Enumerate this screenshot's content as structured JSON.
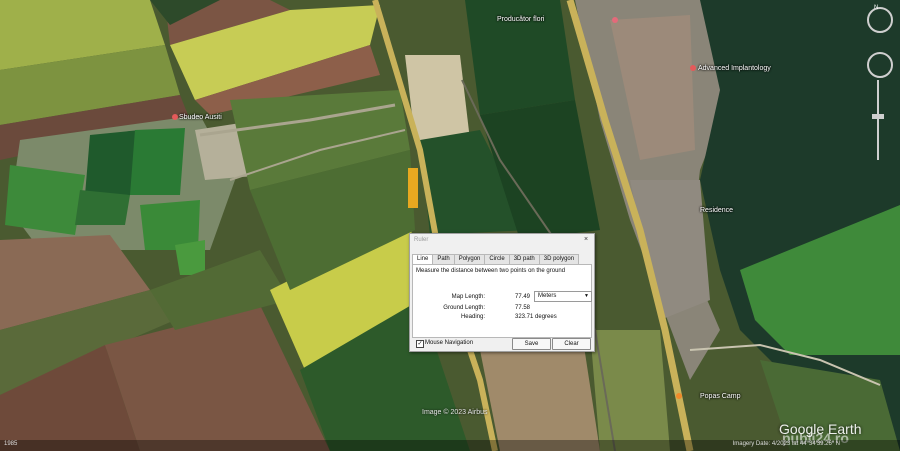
{
  "map": {
    "places": [
      {
        "label": "Producător flori"
      },
      {
        "label": "Advanced Implantology"
      },
      {
        "label": "Sbudeo Ausiti"
      },
      {
        "label": "Residence"
      },
      {
        "label": "Popas Camp"
      }
    ],
    "credit": "Image © 2023 Airbus",
    "watermark": "Google Earth",
    "watermark2": "publi24.ro",
    "status_left": "1985",
    "status_right": "Imagery Date: 4/2023   lat 44°34'39.26\" N",
    "colors": {
      "water": "#1d3a2a",
      "highlight_water": "#3f8a3a",
      "road": "#c9b25a"
    }
  },
  "navigation": {
    "compass_label": "N",
    "icons": [
      "compass-icon",
      "look-joystick-icon",
      "zoom-slider-icon"
    ]
  },
  "ruler": {
    "title": "Ruler",
    "close_icon": "×",
    "tabs": [
      {
        "label": "Line",
        "active": true
      },
      {
        "label": "Path"
      },
      {
        "label": "Polygon"
      },
      {
        "label": "Circle"
      },
      {
        "label": "3D path"
      },
      {
        "label": "3D polygon"
      }
    ],
    "instruction": "Measure the distance between two points on the ground",
    "map_length_label": "Map Length:",
    "map_length_value": "77.49",
    "unit_selected": "Meters",
    "ground_length_label": "Ground Length:",
    "ground_length_value": "77.58",
    "heading_label": "Heading:",
    "heading_value": "323.71 degrees",
    "mouse_nav_label": "Mouse Navigation",
    "mouse_nav_checked": "✓",
    "save_label": "Save",
    "clear_label": "Clear"
  }
}
